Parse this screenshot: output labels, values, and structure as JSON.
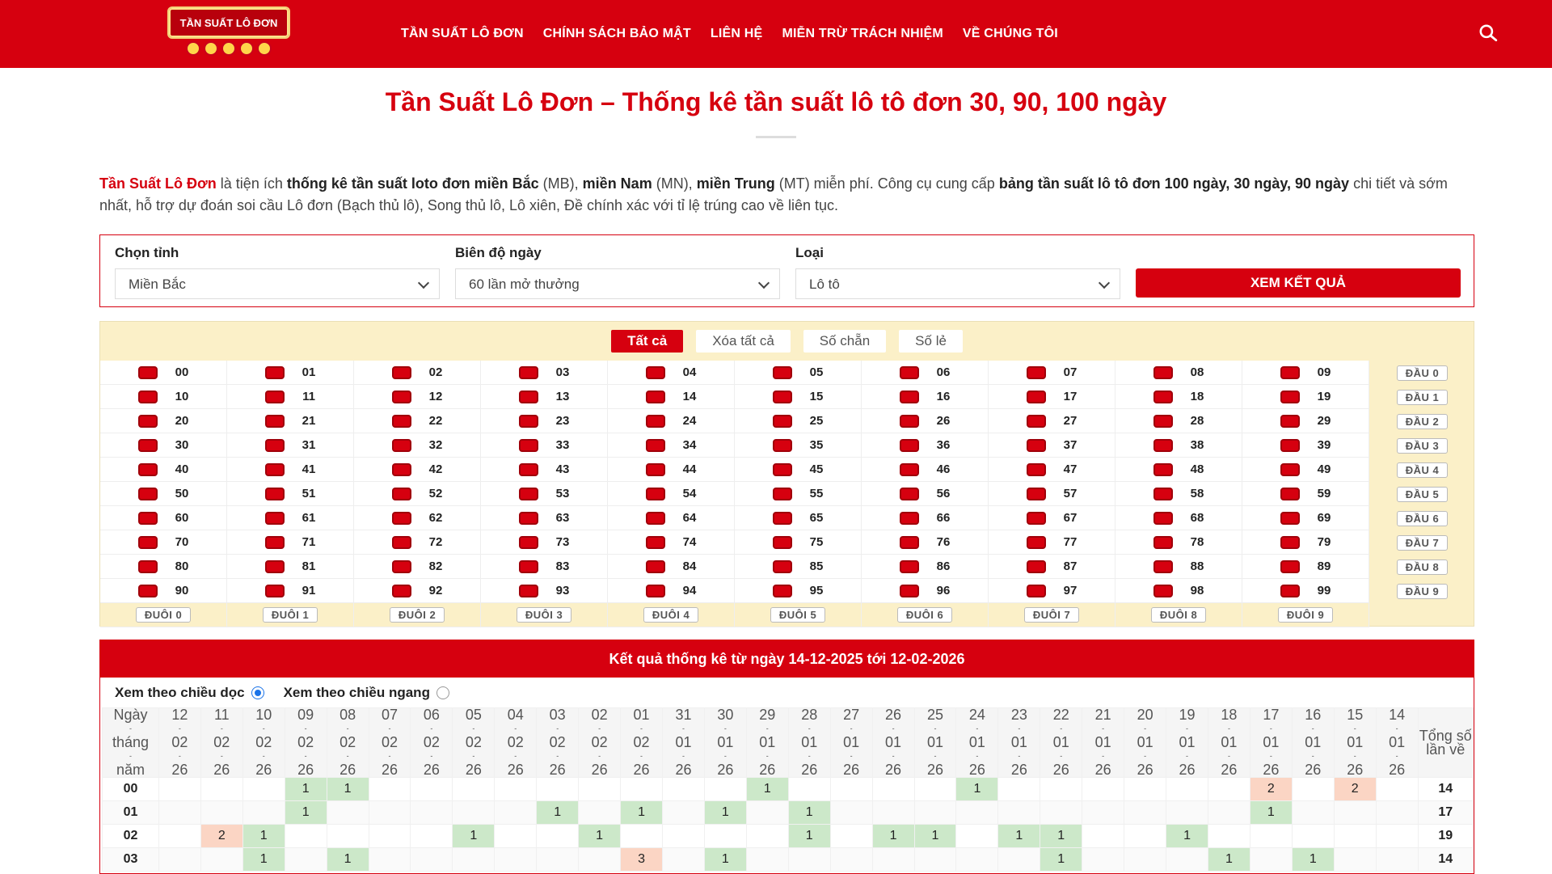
{
  "header": {
    "logo_text": "TẦN SUẤT LÔ ĐƠN",
    "nav": [
      "TẦN SUẤT LÔ ĐƠN",
      "CHÍNH SÁCH BẢO MẬT",
      "LIÊN HỆ",
      "MIỄN TRỪ TRÁCH NHIỆM",
      "VỀ CHÚNG TÔI"
    ],
    "search_icon": "search-icon"
  },
  "page": {
    "title": "Tần Suất Lô Đơn – Thống kê tần suất lô tô đơn 30, 90, 100 ngày",
    "intro": {
      "p1": "Tần Suất Lô Đơn",
      "p2": " là tiện ích ",
      "p3": "thống kê tần suất loto đơn miền Bắc",
      "p4": " (MB), ",
      "p5": "miền Nam",
      "p6": " (MN), ",
      "p7": "miền Trung",
      "p8": " (MT) miễn phí. Công cụ cung cấp ",
      "p9": "bảng tần suất lô tô đơn 100 ngày, 30 ngày, 90 ngày",
      "p10": " chi tiết và sớm nhất, hỗ trợ dự đoán soi cầu Lô đơn (Bạch thủ lô), Song thủ lô, Lô xiên, Đề chính xác với tỉ lệ trúng cao về liên tục."
    }
  },
  "form": {
    "province_label": "Chọn tỉnh",
    "province_value": "Miền Bắc",
    "range_label": "Biên độ ngày",
    "range_value": "60 lần mở thưởng",
    "type_label": "Loại",
    "type_value": "Lô tô",
    "submit_label": "XEM KẾT QUẢ"
  },
  "picker": {
    "tabs": [
      "Tất cả",
      "Xóa tất cả",
      "Số chẵn",
      "Số lẻ"
    ],
    "dau_labels": [
      "ĐẦU 0",
      "ĐẦU 1",
      "ĐẦU 2",
      "ĐẦU 3",
      "ĐẦU 4",
      "ĐẦU 5",
      "ĐẦU 6",
      "ĐẦU 7",
      "ĐẦU 8",
      "ĐẦU 9"
    ],
    "duoi_labels": [
      "ĐUÔI 0",
      "ĐUÔI 1",
      "ĐUÔI 2",
      "ĐUÔI 3",
      "ĐUÔI 4",
      "ĐUÔI 5",
      "ĐUÔI 6",
      "ĐUÔI 7",
      "ĐUÔI 8",
      "ĐUÔI 9"
    ]
  },
  "results": {
    "title": "Kết quả thống kê từ ngày 14-12-2025 tới 12-02-2026",
    "radio_vertical": "Xem theo chiều dọc",
    "radio_horizontal": "Xem theo chiều ngang",
    "first_header": [
      "Ngày",
      "tháng",
      "năm"
    ],
    "last_header": "Tổng số lần về",
    "dates": [
      [
        "12",
        "02",
        "26"
      ],
      [
        "11",
        "02",
        "26"
      ],
      [
        "10",
        "02",
        "26"
      ],
      [
        "09",
        "02",
        "26"
      ],
      [
        "08",
        "02",
        "26"
      ],
      [
        "07",
        "02",
        "26"
      ],
      [
        "06",
        "02",
        "26"
      ],
      [
        "05",
        "02",
        "26"
      ],
      [
        "04",
        "02",
        "26"
      ],
      [
        "03",
        "02",
        "26"
      ],
      [
        "02",
        "02",
        "26"
      ],
      [
        "01",
        "02",
        "26"
      ],
      [
        "31",
        "01",
        "26"
      ],
      [
        "30",
        "01",
        "26"
      ],
      [
        "29",
        "01",
        "26"
      ],
      [
        "28",
        "01",
        "26"
      ],
      [
        "27",
        "01",
        "26"
      ],
      [
        "26",
        "01",
        "26"
      ],
      [
        "25",
        "01",
        "26"
      ],
      [
        "24",
        "01",
        "26"
      ],
      [
        "23",
        "01",
        "26"
      ],
      [
        "22",
        "01",
        "26"
      ],
      [
        "21",
        "01",
        "26"
      ],
      [
        "20",
        "01",
        "26"
      ],
      [
        "19",
        "01",
        "26"
      ],
      [
        "18",
        "01",
        "26"
      ],
      [
        "17",
        "01",
        "26"
      ],
      [
        "16",
        "01",
        "26"
      ],
      [
        "15",
        "01",
        "26"
      ],
      [
        "14",
        "01",
        "26"
      ]
    ],
    "rows": [
      {
        "num": "00",
        "total": "14",
        "cells": [
          "",
          "",
          "",
          "1",
          "1",
          "",
          "",
          "",
          "",
          "",
          "",
          "",
          "",
          "",
          "1",
          "",
          "",
          "",
          "",
          "1",
          "",
          "",
          "",
          "",
          "",
          "",
          "2",
          "",
          "2",
          ""
        ]
      },
      {
        "num": "01",
        "total": "17",
        "cells": [
          "",
          "",
          "",
          "1",
          "",
          "",
          "",
          "",
          "",
          "1",
          "",
          "1",
          "",
          "1",
          "",
          "1",
          "",
          "",
          "",
          "",
          "",
          "",
          "",
          "",
          "",
          "",
          "1",
          "",
          "",
          ""
        ]
      },
      {
        "num": "02",
        "total": "19",
        "cells": [
          "",
          "2",
          "1",
          "",
          "",
          "",
          "",
          "1",
          "",
          "",
          "1",
          "",
          "",
          "",
          "",
          "1",
          "",
          "1",
          "1",
          "",
          "1",
          "1",
          "",
          "",
          "1",
          "",
          "",
          "",
          "",
          ""
        ]
      },
      {
        "num": "03",
        "total": "14",
        "cells": [
          "",
          "",
          "1",
          "",
          "1",
          "",
          "",
          "",
          "",
          "",
          "",
          "3",
          "",
          "1",
          "",
          "",
          "",
          "",
          "",
          "",
          "",
          "1",
          "",
          "",
          "",
          "1",
          "",
          "1",
          "",
          ""
        ]
      }
    ]
  }
}
